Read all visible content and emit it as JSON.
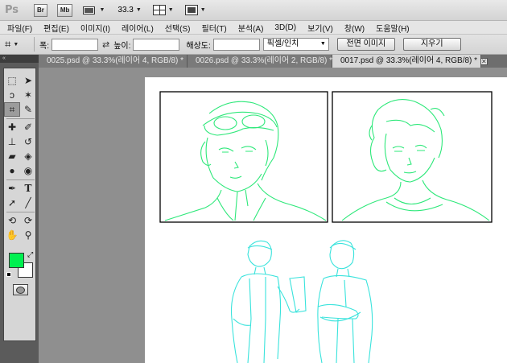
{
  "appbar": {
    "logo": "Ps",
    "bridge_label": "Br",
    "minibridge_label": "Mb",
    "zoom": "33.3"
  },
  "menu": [
    "파일(F)",
    "편집(E)",
    "이미지(I)",
    "레이어(L)",
    "선택(S)",
    "필터(T)",
    "분석(A)",
    "3D(D)",
    "보기(V)",
    "창(W)",
    "도움말(H)"
  ],
  "options": {
    "width_label": "폭:",
    "width_value": "",
    "height_label": "높이:",
    "height_value": "",
    "resolution_label": "해상도:",
    "resolution_value": "",
    "unit_select": "픽셀/인치",
    "front_image_button": "전면 이미지",
    "clear_button": "지우기"
  },
  "tabs": [
    {
      "label": "0025.psd @ 33.3%(레이어 4, RGB/8) *"
    },
    {
      "label": "0026.psd @ 33.3%(레이어 2, RGB/8) *"
    },
    {
      "label": "0017.psd @ 33.3%(레이어 4, RGB/8) *"
    }
  ],
  "colors": {
    "foreground": "#00f050",
    "background": "#ffffff",
    "line_green": "#2ee87a",
    "line_cyan": "#39e3dc"
  },
  "icons": [
    "marquee-icon",
    "move-icon",
    "lasso-icon",
    "magic-wand-icon",
    "crop-icon",
    "eyedropper-icon",
    "healing-icon",
    "brush-icon",
    "stamp-icon",
    "history-brush-icon",
    "eraser-icon",
    "paint-bucket-icon",
    "blur-icon",
    "dodge-icon",
    "pen-icon",
    "type-icon",
    "path-select-icon",
    "line-icon",
    "3d-rotate-icon",
    "3d-orbit-icon",
    "hand-icon",
    "zoom-icon"
  ]
}
